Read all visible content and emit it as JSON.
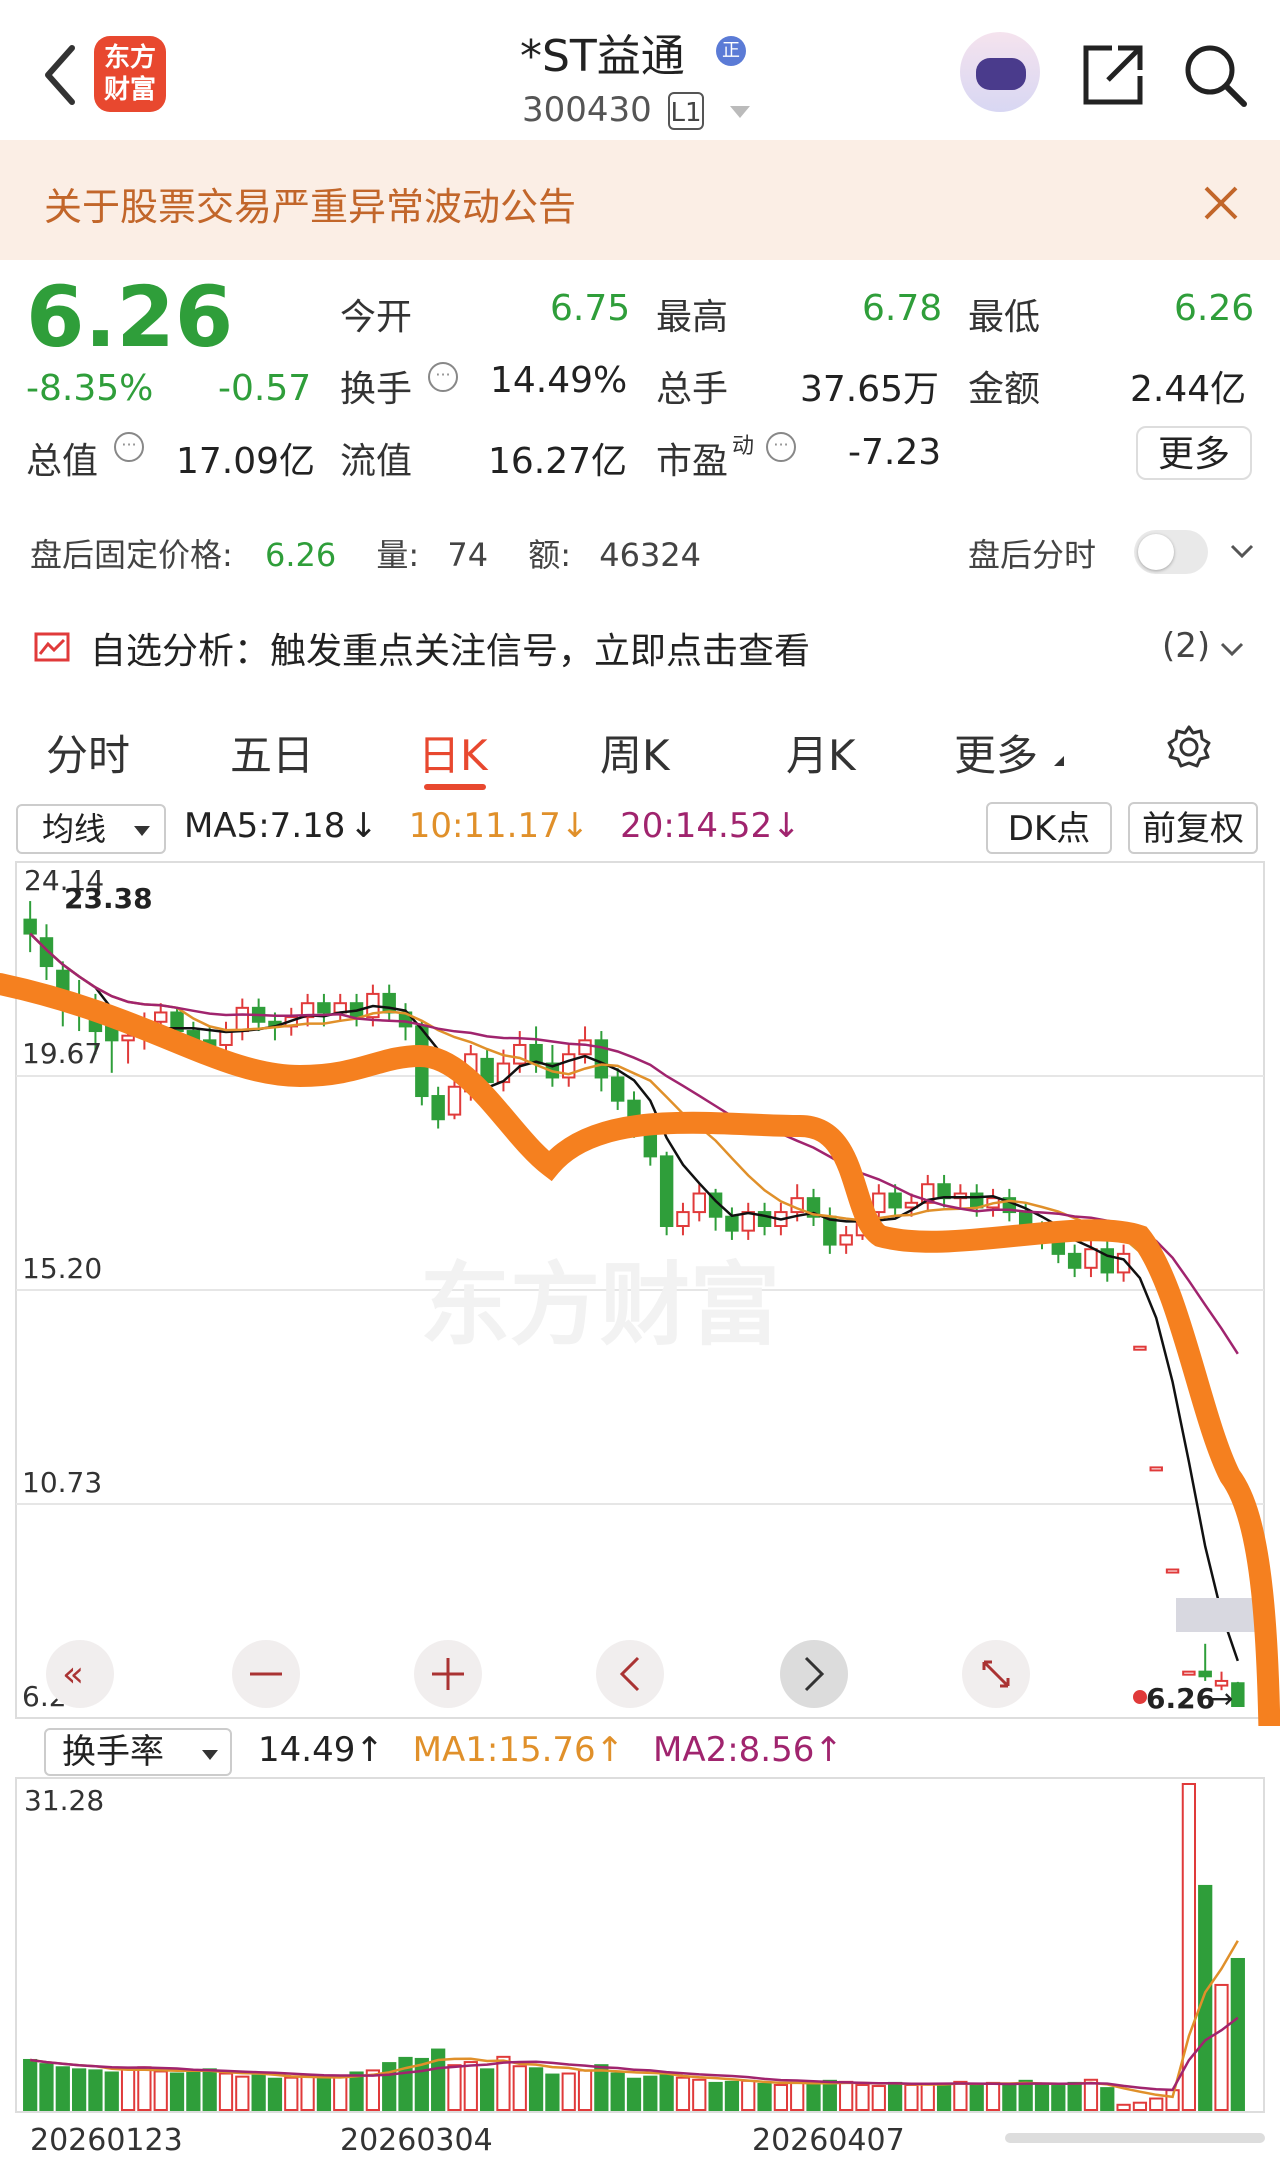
{
  "header": {
    "logo_top": "东方",
    "logo_bottom": "财富",
    "title": "*ST益通",
    "title_badge": "正",
    "code": "300430",
    "level": "L1"
  },
  "banner": {
    "text": "关于股票交易严重异常波动公告"
  },
  "quote": {
    "price": "6.26",
    "change_pct": "-8.35%",
    "change": "-0.57",
    "open_label": "今开",
    "open": "6.75",
    "high_label": "最高",
    "high": "6.78",
    "low_label": "最低",
    "low": "6.26",
    "turnover_label": "换手",
    "turnover": "14.49%",
    "volume_label": "总手",
    "volume": "37.65万",
    "amount_label": "金额",
    "amount": "2.44亿",
    "mktcap_label": "总值",
    "mktcap": "17.09亿",
    "float_label": "流值",
    "float": "16.27亿",
    "pe_label": "市盈",
    "pe_sup": "动",
    "pe": "-7.23",
    "more_button": "更多"
  },
  "aftermarket": {
    "label": "盘后固定价格:",
    "price": "6.26",
    "vol_label": "量:",
    "vol": "74",
    "amt_label": "额:",
    "amt": "46324",
    "toggle_label": "盘后分时"
  },
  "analysis": {
    "text": "自选分析：触发重点关注信号，立即点击查看",
    "count": "(2)"
  },
  "tabs": [
    "分时",
    "五日",
    "日K",
    "周K",
    "月K",
    "更多"
  ],
  "active_tab": "日K",
  "kline_controls": {
    "indicator": "均线",
    "ma_text": "MA5:7.18",
    "ma10_text": "10:11.17",
    "ma20_text": "20:14.52",
    "dk_button": "DK点",
    "adjust_button": "前复权"
  },
  "kline_axis": {
    "high_label": "24.14",
    "high_mark": "23.38",
    "ticks": [
      "19.67",
      "15.20",
      "10.73",
      "6.26"
    ],
    "last_price_label": "6.26"
  },
  "watermark": "东方财富",
  "turnover_controls": {
    "indicator": "换手率",
    "value": "14.49",
    "ma1": "MA1:15.76",
    "ma2": "MA2:8.56",
    "axis_max": "31.28"
  },
  "dates": [
    "20260123",
    "20260304",
    "20260407"
  ],
  "colors": {
    "up": "#e03a3a",
    "down": "#2f9e3a",
    "ma5": "#111111",
    "ma10": "#e0902a",
    "ma20": "#a0246e",
    "annotation": "#f5801f",
    "brand": "#e8482f"
  },
  "chart_data": {
    "type": "candlestick",
    "ylim": [
      6.26,
      24.14
    ],
    "turnover_ylim": [
      0,
      31.28
    ],
    "candles": [
      {
        "o": 23.2,
        "c": 22.9,
        "h": 23.6,
        "l": 22.5
      },
      {
        "o": 22.8,
        "c": 22.2,
        "h": 23.1,
        "l": 21.9
      },
      {
        "o": 22.1,
        "c": 21.6,
        "h": 22.3,
        "l": 20.9
      },
      {
        "o": 21.5,
        "c": 21.2,
        "h": 21.9,
        "l": 20.8
      },
      {
        "o": 21.3,
        "c": 20.8,
        "h": 21.6,
        "l": 20.3
      },
      {
        "o": 20.9,
        "c": 20.6,
        "h": 21.2,
        "l": 19.9
      },
      {
        "o": 20.6,
        "c": 20.7,
        "h": 21.0,
        "l": 20.1
      },
      {
        "o": 20.7,
        "c": 21.0,
        "h": 21.2,
        "l": 20.4
      },
      {
        "o": 21.0,
        "c": 21.2,
        "h": 21.4,
        "l": 20.8
      },
      {
        "o": 21.2,
        "c": 20.8,
        "h": 21.3,
        "l": 20.5
      },
      {
        "o": 20.8,
        "c": 20.6,
        "h": 21.0,
        "l": 20.3
      },
      {
        "o": 20.6,
        "c": 20.5,
        "h": 20.9,
        "l": 20.3
      },
      {
        "o": 20.5,
        "c": 20.8,
        "h": 21.0,
        "l": 20.2
      },
      {
        "o": 20.8,
        "c": 21.3,
        "h": 21.5,
        "l": 20.6
      },
      {
        "o": 21.3,
        "c": 21.0,
        "h": 21.5,
        "l": 20.8
      },
      {
        "o": 21.0,
        "c": 20.9,
        "h": 21.2,
        "l": 20.6
      },
      {
        "o": 20.9,
        "c": 21.1,
        "h": 21.3,
        "l": 20.7
      },
      {
        "o": 21.1,
        "c": 21.4,
        "h": 21.6,
        "l": 20.9
      },
      {
        "o": 21.4,
        "c": 21.2,
        "h": 21.6,
        "l": 20.9
      },
      {
        "o": 21.2,
        "c": 21.4,
        "h": 21.6,
        "l": 21.0
      },
      {
        "o": 21.4,
        "c": 21.1,
        "h": 21.6,
        "l": 20.9
      },
      {
        "o": 21.1,
        "c": 21.6,
        "h": 21.8,
        "l": 20.9
      },
      {
        "o": 21.6,
        "c": 21.2,
        "h": 21.8,
        "l": 21.0
      },
      {
        "o": 21.2,
        "c": 20.9,
        "h": 21.4,
        "l": 20.6
      },
      {
        "o": 20.9,
        "c": 19.4,
        "h": 21.0,
        "l": 19.2
      },
      {
        "o": 19.4,
        "c": 18.9,
        "h": 19.6,
        "l": 18.7
      },
      {
        "o": 19.0,
        "c": 19.6,
        "h": 19.9,
        "l": 18.9
      },
      {
        "o": 19.5,
        "c": 20.3,
        "h": 20.5,
        "l": 19.3
      },
      {
        "o": 20.2,
        "c": 19.7,
        "h": 20.4,
        "l": 19.5
      },
      {
        "o": 19.7,
        "c": 20.1,
        "h": 20.4,
        "l": 19.5
      },
      {
        "o": 20.1,
        "c": 20.5,
        "h": 20.8,
        "l": 19.9
      },
      {
        "o": 20.5,
        "c": 20.1,
        "h": 20.9,
        "l": 19.9
      },
      {
        "o": 20.1,
        "c": 19.8,
        "h": 20.5,
        "l": 19.6
      },
      {
        "o": 19.8,
        "c": 20.3,
        "h": 20.5,
        "l": 19.6
      },
      {
        "o": 20.3,
        "c": 20.6,
        "h": 20.9,
        "l": 20.1
      },
      {
        "o": 20.6,
        "c": 19.8,
        "h": 20.8,
        "l": 19.5
      },
      {
        "o": 19.8,
        "c": 19.3,
        "h": 20.0,
        "l": 19.1
      },
      {
        "o": 19.3,
        "c": 18.7,
        "h": 19.5,
        "l": 18.5
      },
      {
        "o": 18.7,
        "c": 18.1,
        "h": 18.9,
        "l": 17.9
      },
      {
        "o": 18.1,
        "c": 16.6,
        "h": 18.2,
        "l": 16.4
      },
      {
        "o": 16.6,
        "c": 16.9,
        "h": 17.1,
        "l": 16.4
      },
      {
        "o": 16.9,
        "c": 17.3,
        "h": 17.5,
        "l": 16.7
      },
      {
        "o": 17.3,
        "c": 16.8,
        "h": 17.4,
        "l": 16.5
      },
      {
        "o": 16.8,
        "c": 16.5,
        "h": 17.0,
        "l": 16.3
      },
      {
        "o": 16.5,
        "c": 16.9,
        "h": 17.1,
        "l": 16.3
      },
      {
        "o": 16.9,
        "c": 16.6,
        "h": 17.1,
        "l": 16.4
      },
      {
        "o": 16.6,
        "c": 16.9,
        "h": 17.1,
        "l": 16.4
      },
      {
        "o": 16.9,
        "c": 17.2,
        "h": 17.5,
        "l": 16.7
      },
      {
        "o": 17.2,
        "c": 16.8,
        "h": 17.4,
        "l": 16.6
      },
      {
        "o": 16.8,
        "c": 16.2,
        "h": 17.0,
        "l": 16.0
      },
      {
        "o": 16.2,
        "c": 16.4,
        "h": 16.6,
        "l": 16.0
      },
      {
        "o": 16.4,
        "c": 16.9,
        "h": 17.1,
        "l": 16.3
      },
      {
        "o": 16.9,
        "c": 17.3,
        "h": 17.5,
        "l": 16.7
      },
      {
        "o": 17.3,
        "c": 17.0,
        "h": 17.5,
        "l": 16.8
      },
      {
        "o": 17.0,
        "c": 17.1,
        "h": 17.3,
        "l": 16.8
      },
      {
        "o": 17.1,
        "c": 17.5,
        "h": 17.7,
        "l": 16.9
      },
      {
        "o": 17.5,
        "c": 17.2,
        "h": 17.7,
        "l": 17.0
      },
      {
        "o": 17.2,
        "c": 17.3,
        "h": 17.5,
        "l": 17.0
      },
      {
        "o": 17.3,
        "c": 17.0,
        "h": 17.5,
        "l": 16.8
      },
      {
        "o": 17.0,
        "c": 17.2,
        "h": 17.4,
        "l": 16.8
      },
      {
        "o": 17.2,
        "c": 16.9,
        "h": 17.4,
        "l": 16.7
      },
      {
        "o": 16.9,
        "c": 16.5,
        "h": 17.1,
        "l": 16.3
      },
      {
        "o": 16.5,
        "c": 16.4,
        "h": 16.7,
        "l": 16.1
      },
      {
        "o": 16.4,
        "c": 16.0,
        "h": 16.6,
        "l": 15.8
      },
      {
        "o": 16.0,
        "c": 15.7,
        "h": 16.2,
        "l": 15.5
      },
      {
        "o": 15.7,
        "c": 16.1,
        "h": 16.3,
        "l": 15.5
      },
      {
        "o": 16.1,
        "c": 15.6,
        "h": 16.3,
        "l": 15.4
      },
      {
        "o": 15.6,
        "c": 16.0,
        "h": 16.2,
        "l": 15.4
      },
      {
        "o": 14.0,
        "c": 14.0,
        "h": 14.0,
        "l": 14.0
      },
      {
        "o": 11.4,
        "c": 11.4,
        "h": 11.4,
        "l": 11.4
      },
      {
        "o": 9.2,
        "c": 9.2,
        "h": 9.2,
        "l": 9.2
      },
      {
        "o": 7.0,
        "c": 7.0,
        "h": 7.0,
        "l": 7.0
      },
      {
        "o": 7.0,
        "c": 6.9,
        "h": 7.6,
        "l": 6.8
      },
      {
        "o": 6.7,
        "c": 6.8,
        "h": 7.0,
        "l": 6.6
      },
      {
        "o": 6.75,
        "c": 6.26,
        "h": 6.78,
        "l": 6.26
      }
    ],
    "turnover": [
      4.8,
      4.4,
      4.1,
      3.9,
      3.8,
      3.6,
      3.9,
      4.1,
      3.7,
      3.5,
      3.6,
      3.9,
      3.5,
      3.2,
      3.3,
      3.0,
      3.1,
      3.3,
      3.0,
      3.2,
      3.6,
      3.8,
      4.5,
      5.0,
      4.9,
      5.8,
      4.3,
      4.6,
      3.9,
      5.1,
      4.2,
      4.0,
      3.4,
      3.5,
      3.8,
      4.3,
      3.5,
      3.0,
      3.2,
      3.5,
      3.1,
      2.9,
      2.6,
      2.7,
      2.8,
      2.5,
      2.4,
      2.6,
      2.5,
      2.8,
      2.7,
      2.4,
      2.3,
      2.6,
      2.4,
      2.5,
      2.5,
      2.7,
      2.4,
      2.6,
      2.5,
      2.8,
      2.4,
      2.3,
      2.6,
      2.9,
      2.1,
      0.5,
      0.7,
      1.1,
      1.9,
      31.28,
      21.5,
      12.0,
      14.49
    ]
  }
}
